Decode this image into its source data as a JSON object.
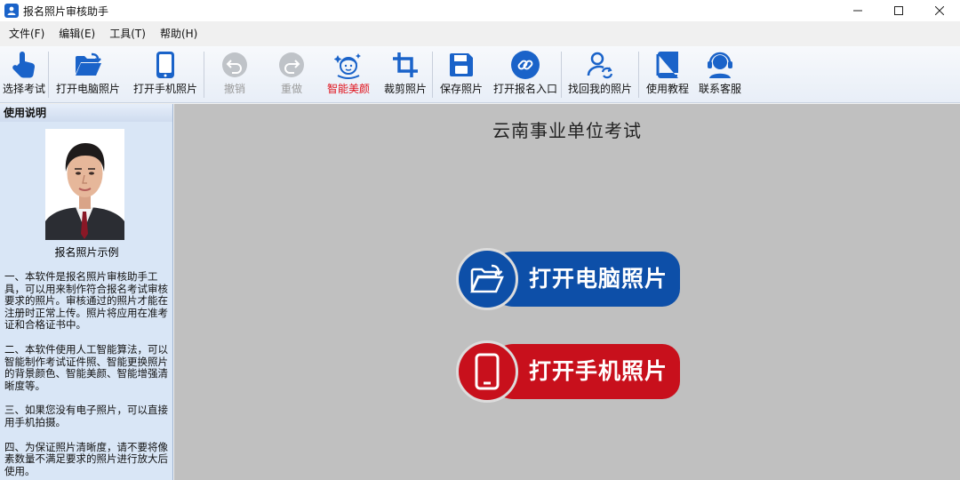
{
  "window": {
    "title": "报名照片审核助手"
  },
  "menu": [
    "文件(F)",
    "编辑(E)",
    "工具(T)",
    "帮助(H)"
  ],
  "toolbar": {
    "select_exam": "选择考试",
    "open_pc_photo": "打开电脑照片",
    "open_phone_photo": "打开手机照片",
    "undo": "撤销",
    "redo": "重做",
    "beauty": "智能美颜",
    "crop": "裁剪照片",
    "save": "保存照片",
    "open_entry": "打开报名入口",
    "find_photo": "找回我的照片",
    "tutorial": "使用教程",
    "support": "联系客服"
  },
  "left_panel": {
    "header": "使用说明",
    "sample_caption": "报名照片示例",
    "paragraphs": [
      "一、本软件是报名照片审核助手工具，可以用来制作符合报名考试审核要求的照片。审核通过的照片才能在注册时正常上传。照片将应用在准考证和合格证书中。",
      "二、本软件使用人工智能算法，可以智能制作考试证件照、智能更换照片的背景颜色、智能美颜、智能增强清晰度等。",
      "三、如果您没有电子照片，可以直接用手机拍摄。",
      "四、为保证照片清晰度，请不要将像素数量不满足要求的照片进行放大后使用。"
    ]
  },
  "main": {
    "exam_title": "云南事业单位考试",
    "open_pc_button": "打开电脑照片",
    "open_phone_button": "打开手机照片"
  },
  "colors": {
    "blue_button": "#0d4fa8",
    "red_button": "#c8101c",
    "toolbar_icon_blue": "#1a63c9",
    "main_bg": "#c0c0c0"
  }
}
